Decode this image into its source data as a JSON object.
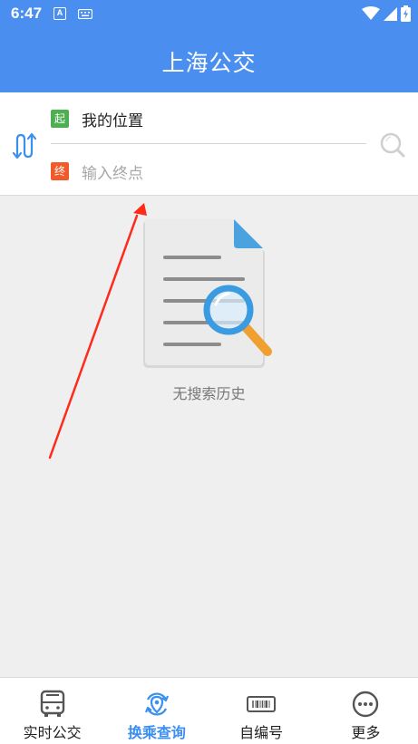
{
  "status_bar": {
    "time": "6:47",
    "notification_letter": "A"
  },
  "header": {
    "title": "上海公交"
  },
  "route": {
    "origin_tag": "起",
    "origin": "我的位置",
    "destination_tag": "终",
    "destination_placeholder": "输入终点"
  },
  "empty_state": {
    "text": "无搜索历史"
  },
  "bottom_nav": {
    "items": [
      {
        "label": "实时公交",
        "icon": "bus-icon"
      },
      {
        "label": "换乘查询",
        "icon": "transfer-icon",
        "active": true
      },
      {
        "label": "自编号",
        "icon": "barcode-icon"
      },
      {
        "label": "更多",
        "icon": "more-icon"
      }
    ]
  },
  "colors": {
    "primary": "#4a8ff0",
    "start_tag": "#4caf50",
    "end_tag": "#f2592b",
    "active_nav": "#3b8ff0",
    "annotation": "#ff2a1a"
  }
}
